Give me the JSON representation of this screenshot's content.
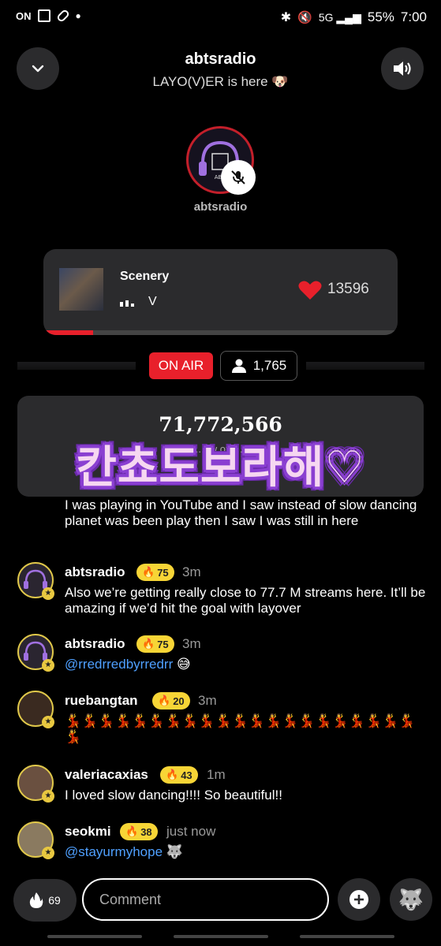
{
  "status_bar": {
    "left_icons": [
      "nfc-icon",
      "gallery-icon",
      "pill-icon",
      "dot-icon"
    ],
    "battery": "55%",
    "time": "7:00"
  },
  "header": {
    "title": "abtsradio",
    "subtitle": "LAYO(V)ER is here 🐶"
  },
  "host": {
    "name": "abtsradio"
  },
  "now_playing": {
    "song": "Scenery",
    "artist": "V",
    "likes": "13596",
    "progress": 0.14
  },
  "room": {
    "on_air_label": "ON AIR",
    "listeners": "1,765"
  },
  "stream": {
    "count": "71,772,566",
    "subtitle": "...aw of 7..."
  },
  "overlay_text": "칸쵸도보라해♡",
  "chat": {
    "previous_message": "I was playing in YouTube and I saw instead of slow dancing planet was been play then I saw I was still in here",
    "messages": [
      {
        "username": "abtsradio",
        "level": "75",
        "time": "3m",
        "text": "Also we’re getting really close to 77.7 M streams here. It’ll be amazing if we’d hit the goal with layover"
      },
      {
        "username": "abtsradio",
        "level": "75",
        "time": "3m",
        "mention": "@rredrredbyrredrr",
        "text": "😅"
      },
      {
        "username": "ruebangtan",
        "level": "20",
        "time": "3m",
        "text": "💃💃💃💃💃💃💃💃💃💃💃💃💃💃💃💃💃💃💃💃💃💃"
      },
      {
        "username": "valeriacaxias",
        "level": "43",
        "time": "1m",
        "text": "I loved slow dancing!!!! So beautiful!!"
      },
      {
        "username": "seokmi",
        "level": "38",
        "time": "just now",
        "mention": "@stayurmyhope",
        "text": "🐺"
      }
    ]
  },
  "bottom_bar": {
    "boost_count": "69",
    "comment_placeholder": "Comment",
    "wolf": "🐺"
  }
}
